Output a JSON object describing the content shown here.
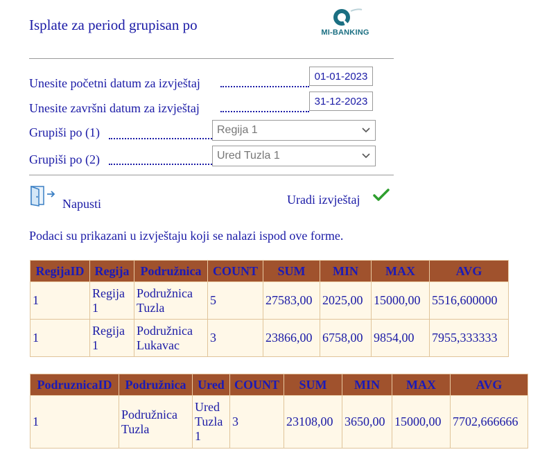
{
  "header": {
    "title": "Isplate za period grupisan po",
    "logo_text": "MI-BANKING"
  },
  "form": {
    "start_label": "Unesite početni datum za izvještaj",
    "start_value": "01-01-2023",
    "end_label": "Unesite završni datum za izvještaj",
    "end_value": "31-12-2023",
    "group1_label": "Grupiši po (1)",
    "group1_value": "Regija 1",
    "group2_label": "Grupiši po (2)",
    "group2_value": "Ured Tuzla 1"
  },
  "actions": {
    "exit_label": "Napusti",
    "run_label": "Uradi izvještaj"
  },
  "note": "Podaci su prikazani u izvještaju koji se nalazi ispod ove forme.",
  "table1": {
    "headers": [
      "RegijaID",
      "Regija",
      "Podružnica",
      "COUNT",
      "SUM",
      "MIN",
      "MAX",
      "AVG"
    ],
    "rows": [
      [
        "1",
        "Regija 1",
        "Podružnica Tuzla",
        "5",
        "27583,00",
        "2025,00",
        "15000,00",
        "5516,600000"
      ],
      [
        "1",
        "Regija 1",
        "Podružnica Lukavac",
        "3",
        "23866,00",
        "6758,00",
        "9854,00",
        "7955,333333"
      ]
    ]
  },
  "table2": {
    "headers": [
      "PodruznicaID",
      "Podružnica",
      "Ured",
      "COUNT",
      "SUM",
      "MIN",
      "MAX",
      "AVG"
    ],
    "rows": [
      [
        "1",
        "Podružnica Tuzla",
        "Ured Tuzla 1",
        "3",
        "23108,00",
        "3650,00",
        "15000,00",
        "7702,666666"
      ]
    ]
  },
  "colors": {
    "header_bg": "#a0522d",
    "cell_bg": "#fff8e8",
    "text": "#1a1aa6",
    "check": "#2e9e2e"
  }
}
